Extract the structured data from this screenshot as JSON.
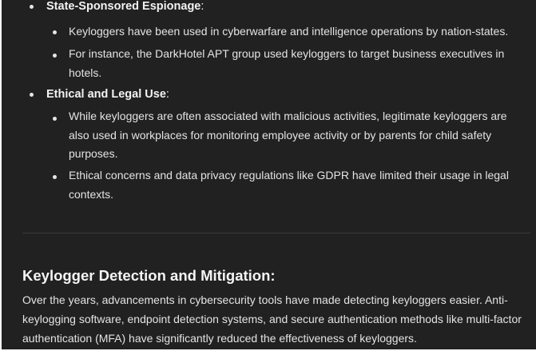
{
  "section_list": [
    {
      "title": "State-Sponsored Espionage",
      "items": [
        "Keyloggers have been used in cyberwarfare and intelligence operations by nation-states.",
        "For instance, the DarkHotel APT group used keyloggers to target business executives in hotels."
      ]
    },
    {
      "title": "Ethical and Legal Use",
      "items": [
        "While keyloggers are often associated with malicious activities, legitimate keyloggers are also used in workplaces for monitoring employee activity or by parents for child safety purposes.",
        "Ethical concerns and data privacy regulations like GDPR have limited their usage in legal contexts."
      ]
    }
  ],
  "heading": "Keylogger Detection and Mitigation:",
  "paragraph": "Over the years, advancements in cybersecurity tools have made detecting keyloggers easier. Anti-keylogging software, endpoint detection systems, and secure authentication methods like multi-factor authentication (MFA) have significantly reduced the effectiveness of keyloggers.",
  "colors": {
    "background": "#212121",
    "text": "#ececec",
    "divider": "#3d3d3d"
  }
}
